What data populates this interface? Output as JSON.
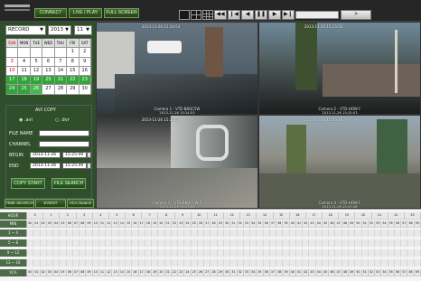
{
  "toolbar": {
    "connect_label": "CONNECT",
    "live_play_label": "LIVE / PLAY",
    "full_screen_label": "FULL SCREEN",
    "icons": {
      "layout_1": "single-view-icon",
      "layout_4": "quad-view-icon",
      "layout_9": "nine-view-icon",
      "layout_16": "sixteen-view-icon",
      "fast_rewind": "fast-rewind-icon",
      "step_back": "step-back-icon",
      "rewind": "rewind-icon",
      "pause": "pause-icon",
      "play": "play-icon",
      "step_forward": "step-forward-icon",
      "fast_forward": "fast-forward-icon"
    },
    "go_label": ">"
  },
  "sidebar": {
    "mode_value": "RECORD",
    "year_value": "2013",
    "month_value": "11",
    "calendar": {
      "weekdays": [
        "SUN",
        "MON",
        "TUE",
        "WED",
        "THU",
        "FRI",
        "SAT"
      ],
      "rows": [
        [
          "",
          "",
          "",
          "",
          "",
          "1",
          "2"
        ],
        [
          "3",
          "4",
          "5",
          "6",
          "7",
          "8",
          "9"
        ],
        [
          "10",
          "11",
          "12",
          "13",
          "14",
          "15",
          "16"
        ],
        [
          "17",
          "18",
          "19",
          "20",
          "21",
          "22",
          "23"
        ],
        [
          "24",
          "25",
          "26",
          "27",
          "28",
          "29",
          "30"
        ]
      ]
    },
    "avi_copy_label": "AVI COPY",
    "format_avi": ".avi",
    "format_dvr": ".dvr",
    "file_name_label": "FILE NAME",
    "channel_label": "CHANNEL",
    "begin_label": "BEGIN",
    "begin_date": "2013-11-26",
    "begin_time": "15:25:49",
    "end_label": "END",
    "end_date": "2013-11-26",
    "end_time": "15:25:49",
    "copy_start_label": "COPY START",
    "file_search_label": "FILE SEARCH",
    "tabs": [
      "TIME SEARCH",
      "EVENT SEARCH",
      "VCA Search"
    ]
  },
  "cameras": [
    {
      "label": "Camera 1 - VTD-B8QC5W",
      "time": "2013-11-26 15:24:53"
    },
    {
      "label": "Camera 2 - VTD-HOW F",
      "time": "2013-11-26 15:25:03"
    },
    {
      "label": "Camera 3 - VTD-B8QC5W F",
      "time": "2013-11-26 15:23:58"
    },
    {
      "label": "Camera 4 - VTD-HOW F",
      "time": "2013-11-26 15:25:48"
    }
  ],
  "timeline": {
    "labels": [
      "HOUR",
      "MIN",
      "1 ~ 4",
      "5 ~ 8",
      "9 ~ 12",
      "13 ~ 16",
      "VCA"
    ],
    "hours": [
      "0",
      "1",
      "2",
      "3",
      "4",
      "5",
      "6",
      "7",
      "8",
      "9",
      "10",
      "11",
      "12",
      "13",
      "14",
      "15",
      "16",
      "17",
      "18",
      "19",
      "20",
      "21",
      "22",
      "23"
    ],
    "minutes": [
      "00",
      "01",
      "02",
      "03",
      "04",
      "05",
      "06",
      "07",
      "08",
      "09",
      "10",
      "11",
      "12",
      "13",
      "14",
      "15",
      "16",
      "17",
      "18",
      "19",
      "20",
      "21",
      "22",
      "23",
      "24",
      "25",
      "26",
      "27",
      "28",
      "29",
      "30",
      "31",
      "32",
      "33",
      "34",
      "35",
      "36",
      "37",
      "38",
      "39",
      "40",
      "41",
      "42",
      "43",
      "44",
      "45",
      "46",
      "47",
      "48",
      "49",
      "50",
      "51",
      "52",
      "53",
      "54",
      "55",
      "56",
      "57",
      "58",
      "59"
    ]
  },
  "colors": {
    "panel_green": "#2f4f2a",
    "button_green": "#3f6e2a",
    "calendar_highlight": "#33a43a"
  }
}
